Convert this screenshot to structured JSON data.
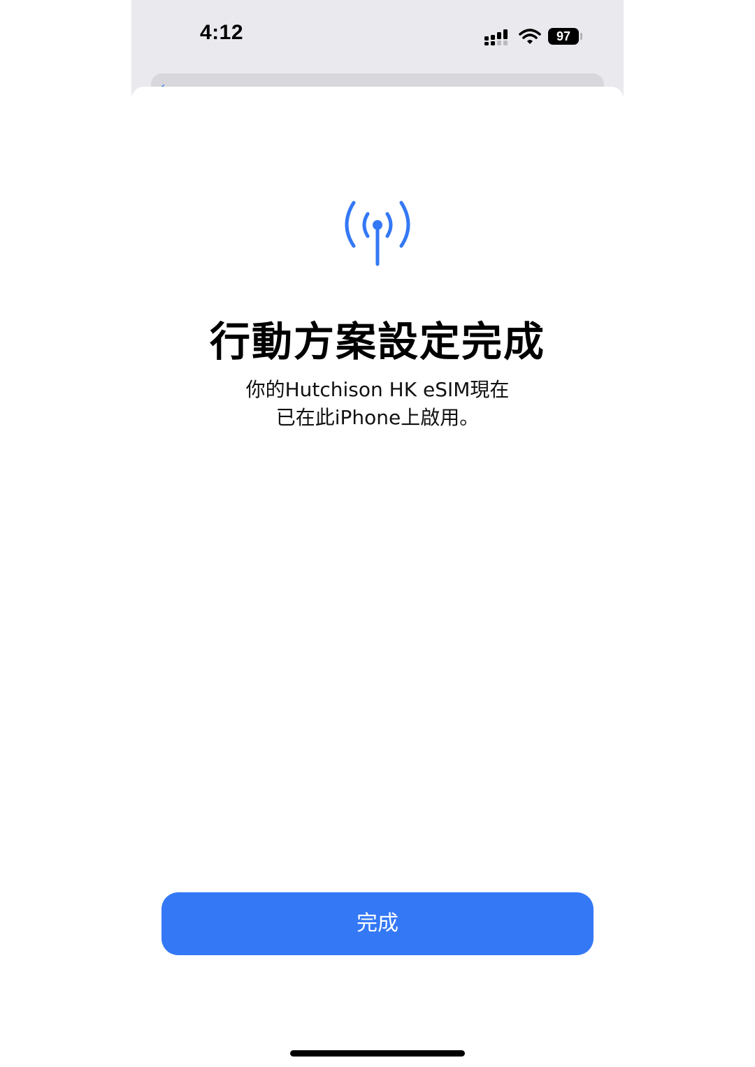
{
  "status_bar": {
    "time": "4:12",
    "battery_level": "97",
    "signal_icon": "cellular-signal-icon",
    "wifi_icon": "wifi-icon"
  },
  "background_nav": {
    "back_icon": "chevron-left-icon"
  },
  "content": {
    "icon": "antenna-radiowaves-icon",
    "title": "行動方案設定完成",
    "subtitle": "你的Hutchison HK eSIM現在已在此iPhone上啟用。"
  },
  "actions": {
    "done_label": "完成"
  },
  "colors": {
    "accent": "#3478f6",
    "background": "#ffffff",
    "behind_sheet": "#e9e9ee"
  }
}
